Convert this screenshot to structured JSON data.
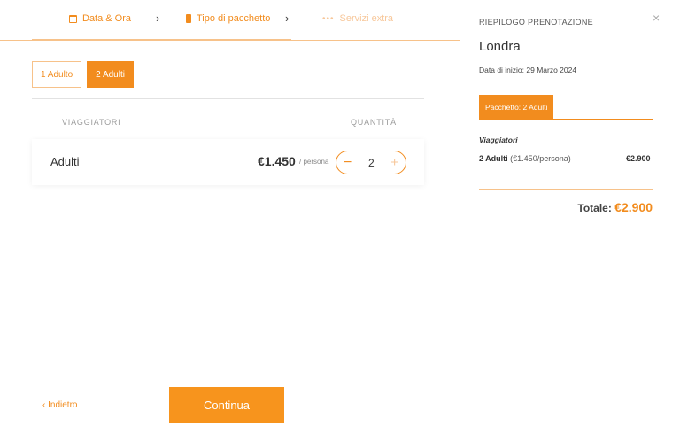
{
  "steps": [
    {
      "label": "Data & Ora",
      "icon": "calendar-icon",
      "state": "done"
    },
    {
      "label": "Tipo di pacchetto",
      "icon": "package-icon",
      "state": "active"
    },
    {
      "label": "Servizi extra",
      "icon": "dots-icon",
      "state": "upcoming"
    }
  ],
  "step_separator": "›",
  "package_tabs": [
    {
      "label": "1 Adulto",
      "active": false
    },
    {
      "label": "2 Adulti",
      "active": true
    }
  ],
  "table": {
    "col_travellers": "VIAGGIATORI",
    "col_quantity": "QUANTITÀ"
  },
  "row": {
    "label": "Adulti",
    "price": "€1.450",
    "per": "/ persona",
    "minus": "−",
    "quantity": "2",
    "plus": "+"
  },
  "footer": {
    "back_label": "‹ Indietro",
    "continue_label": "Continua"
  },
  "summary": {
    "heading": "RIEPILOGO PRENOTAZIONE",
    "close": "×",
    "city": "Londra",
    "start_date": "Data di inizio: 29 Marzo 2024",
    "package_label": "Pacchetto: 2 Adulti",
    "travellers_label": "Viaggiatori",
    "traveller_line_bold": "2 Adulti",
    "traveller_line_detail": " (€1.450/persona)",
    "traveller_amount": "€2.900",
    "total_label": "Totale: ",
    "total_amount": "€2.900"
  },
  "colors": {
    "accent": "#f28c1e",
    "accent_light": "#f7c28a"
  }
}
